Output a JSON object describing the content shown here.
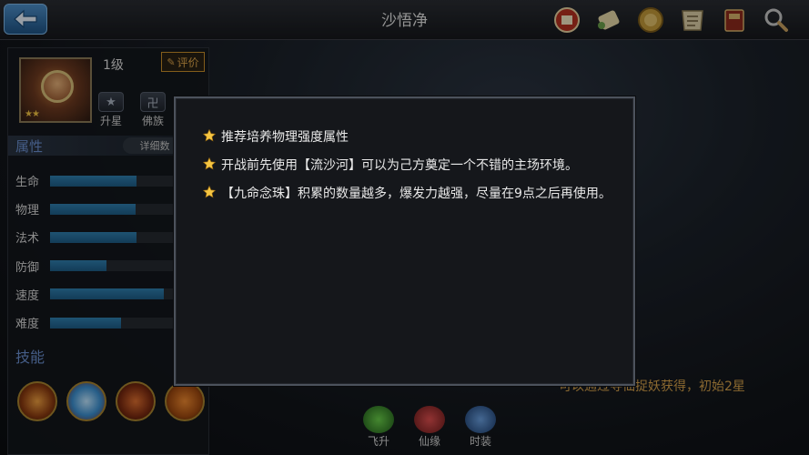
{
  "header": {
    "title": "沙悟净"
  },
  "hero": {
    "level": "1级",
    "rate_label": "评价",
    "tags": [
      {
        "label": "升星",
        "icon": "star-badge-icon"
      },
      {
        "label": "佛族",
        "icon": "swastika-badge-icon"
      }
    ]
  },
  "attributes": {
    "title": "属性",
    "detail_label": "详细数",
    "stats": [
      {
        "label": "生命",
        "value": 0.57
      },
      {
        "label": "物理",
        "value": 0.56
      },
      {
        "label": "法术",
        "value": 0.57
      },
      {
        "label": "防御",
        "value": 0.37
      },
      {
        "label": "速度",
        "value": 0.75
      },
      {
        "label": "难度",
        "value": 0.47
      }
    ]
  },
  "skills": {
    "title": "技能"
  },
  "acquire_text": "可以通过寻仙捉妖获得，初始2星",
  "bottom_tabs": [
    {
      "label": "飞升"
    },
    {
      "label": "仙缘"
    },
    {
      "label": "时装"
    }
  ],
  "dialog": {
    "tips": [
      {
        "text": "推荐培养物理强度属性"
      },
      {
        "text": "开战前先使用【流沙河】可以为己方奠定一个不错的主场环境。"
      },
      {
        "text": "【九命念珠】积累的数量越多，爆发力越强，尽量在9点之后再使用。"
      }
    ]
  },
  "colors": {
    "accent": "#6a8fd0",
    "bar": "#2f7fb0",
    "star": "#f5c542",
    "gold": "#d6a14a"
  }
}
